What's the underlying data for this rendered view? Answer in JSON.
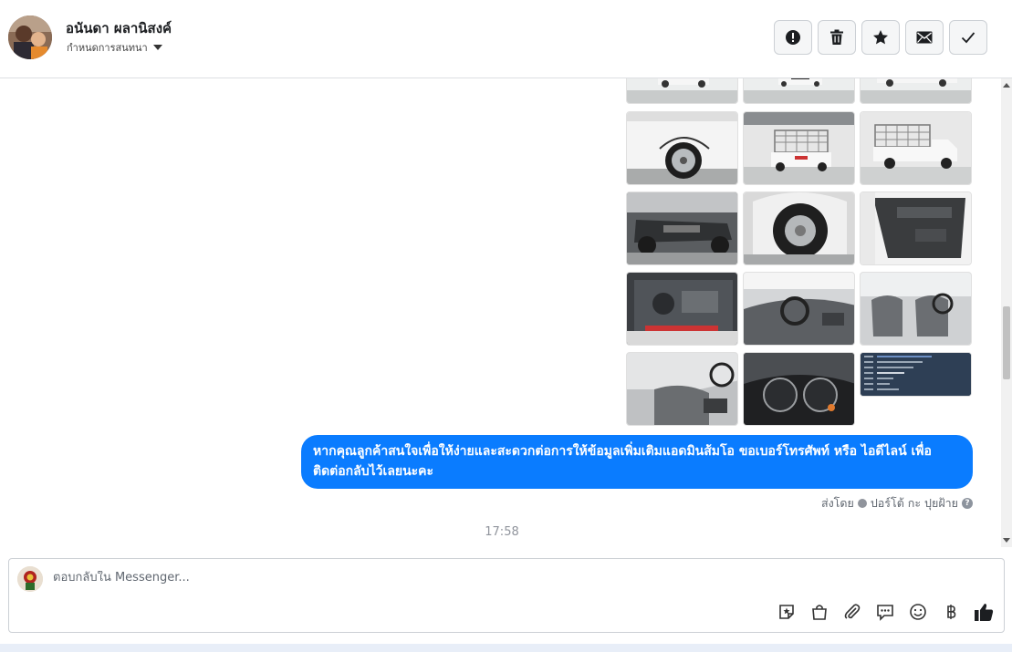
{
  "header": {
    "contact_name": "อนันดา ผลานิสงค์",
    "assign_label": "กำหนดการสนทนา",
    "actions": [
      {
        "name": "spam",
        "icon": "exclamation-circle-icon"
      },
      {
        "name": "delete",
        "icon": "trash-icon"
      },
      {
        "name": "star",
        "icon": "star-icon"
      },
      {
        "name": "unread",
        "icon": "envelope-icon"
      },
      {
        "name": "done",
        "icon": "checkmark-icon"
      }
    ]
  },
  "conversation": {
    "photo_count": 15,
    "message_text": "หากคุณลูกค้าสนใจเพื่อให้ง่ายและสะดวกต่อการให้ข้อมูลเพิ่มเติมแอดมินส้มโอ ขอเบอร์โทรศัพท์ หรือ ไอดีไลน์ เพื่อติดต่อกลับไว้เลยนะคะ",
    "sent_by_label": "ส่งโดย",
    "sender_name": "ปอร์โต้ กะ ปุยฝ้าย",
    "timestamp": "17:58"
  },
  "composer": {
    "placeholder": "ตอบกลับใน Messenger...",
    "tools": [
      "sticker-icon",
      "shopping-bag-icon",
      "paperclip-icon",
      "saved-reply-icon",
      "emoji-icon",
      "baht-payment-icon",
      "thumbs-up-icon"
    ]
  },
  "colors": {
    "bubble": "#0a7cff",
    "border": "#ccd0d5",
    "muted": "#90949c"
  }
}
